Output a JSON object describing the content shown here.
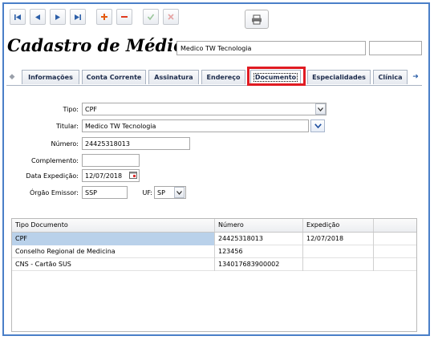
{
  "colors": {
    "window_border": "#4a7fc8",
    "highlight": "#e01b22",
    "selection": "#b9d1ea",
    "tab_text": "#1b2a4a"
  },
  "toolbar": {
    "buttons": [
      {
        "icon": "first-record-icon"
      },
      {
        "icon": "previous-record-icon"
      },
      {
        "icon": "next-record-icon"
      },
      {
        "icon": "last-record-icon"
      },
      {
        "icon": "add-icon"
      },
      {
        "icon": "remove-icon"
      },
      {
        "icon": "confirm-icon"
      },
      {
        "icon": "cancel-icon"
      }
    ],
    "print_icon": "printer-icon"
  },
  "header": {
    "title": "Cadastro de Médicos",
    "name_value": "Medico TW Tecnologia",
    "extra_value": ""
  },
  "tabs": {
    "items": [
      "Informações",
      "Conta Corrente",
      "Assinatura",
      "Endereço",
      "Documento",
      "Especialidades",
      "Clínica"
    ],
    "active": "Documento"
  },
  "form": {
    "tipo_label": "Tipo:",
    "tipo_value": "CPF",
    "titular_label": "Titular:",
    "titular_value": "Medico TW Tecnologia",
    "numero_label": "Número:",
    "numero_value": "24425318013",
    "complemento_label": "Complemento:",
    "complemento_value": "",
    "expedicao_label": "Data Expedição:",
    "expedicao_value": "12/07/2018",
    "orgao_label": "Órgão Emissor:",
    "orgao_value": "SSP",
    "uf_label": "UF:",
    "uf_value": "SP"
  },
  "grid": {
    "columns": [
      "Tipo Documento",
      "Número",
      "Expedição"
    ],
    "rows": [
      [
        "CPF",
        "24425318013",
        "12/07/2018"
      ],
      [
        "Conselho Regional de Medicina",
        "123456",
        ""
      ],
      [
        "CNS - Cartão SUS",
        "134017683900002",
        ""
      ]
    ]
  }
}
